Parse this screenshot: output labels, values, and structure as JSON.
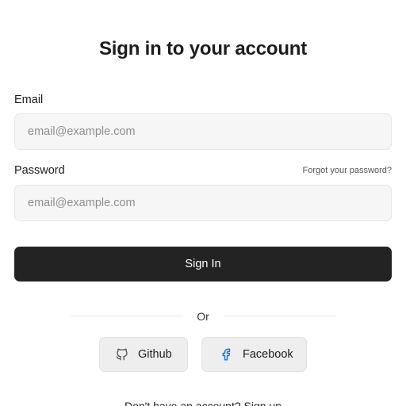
{
  "form": {
    "title": "Sign in to your account",
    "email_label": "Email",
    "email_placeholder": "email@example.com",
    "email_value": "",
    "password_label": "Password",
    "password_placeholder": "email@example.com",
    "password_value": "",
    "forgot_password": "Forgot your password?",
    "signin_label": "Sign In"
  },
  "divider": {
    "label": "Or"
  },
  "social": {
    "github": {
      "label": "Github",
      "icon": "github-icon"
    },
    "facebook": {
      "label": "Facebook",
      "icon": "facebook-icon",
      "color": "#1877f2"
    }
  },
  "footer": {
    "prompt": "Don't have an account?",
    "signup_label": "Sign up"
  },
  "colors": {
    "primary_button": "#232323",
    "input_background": "#f6f6f6",
    "social_background": "#eeeeee"
  }
}
